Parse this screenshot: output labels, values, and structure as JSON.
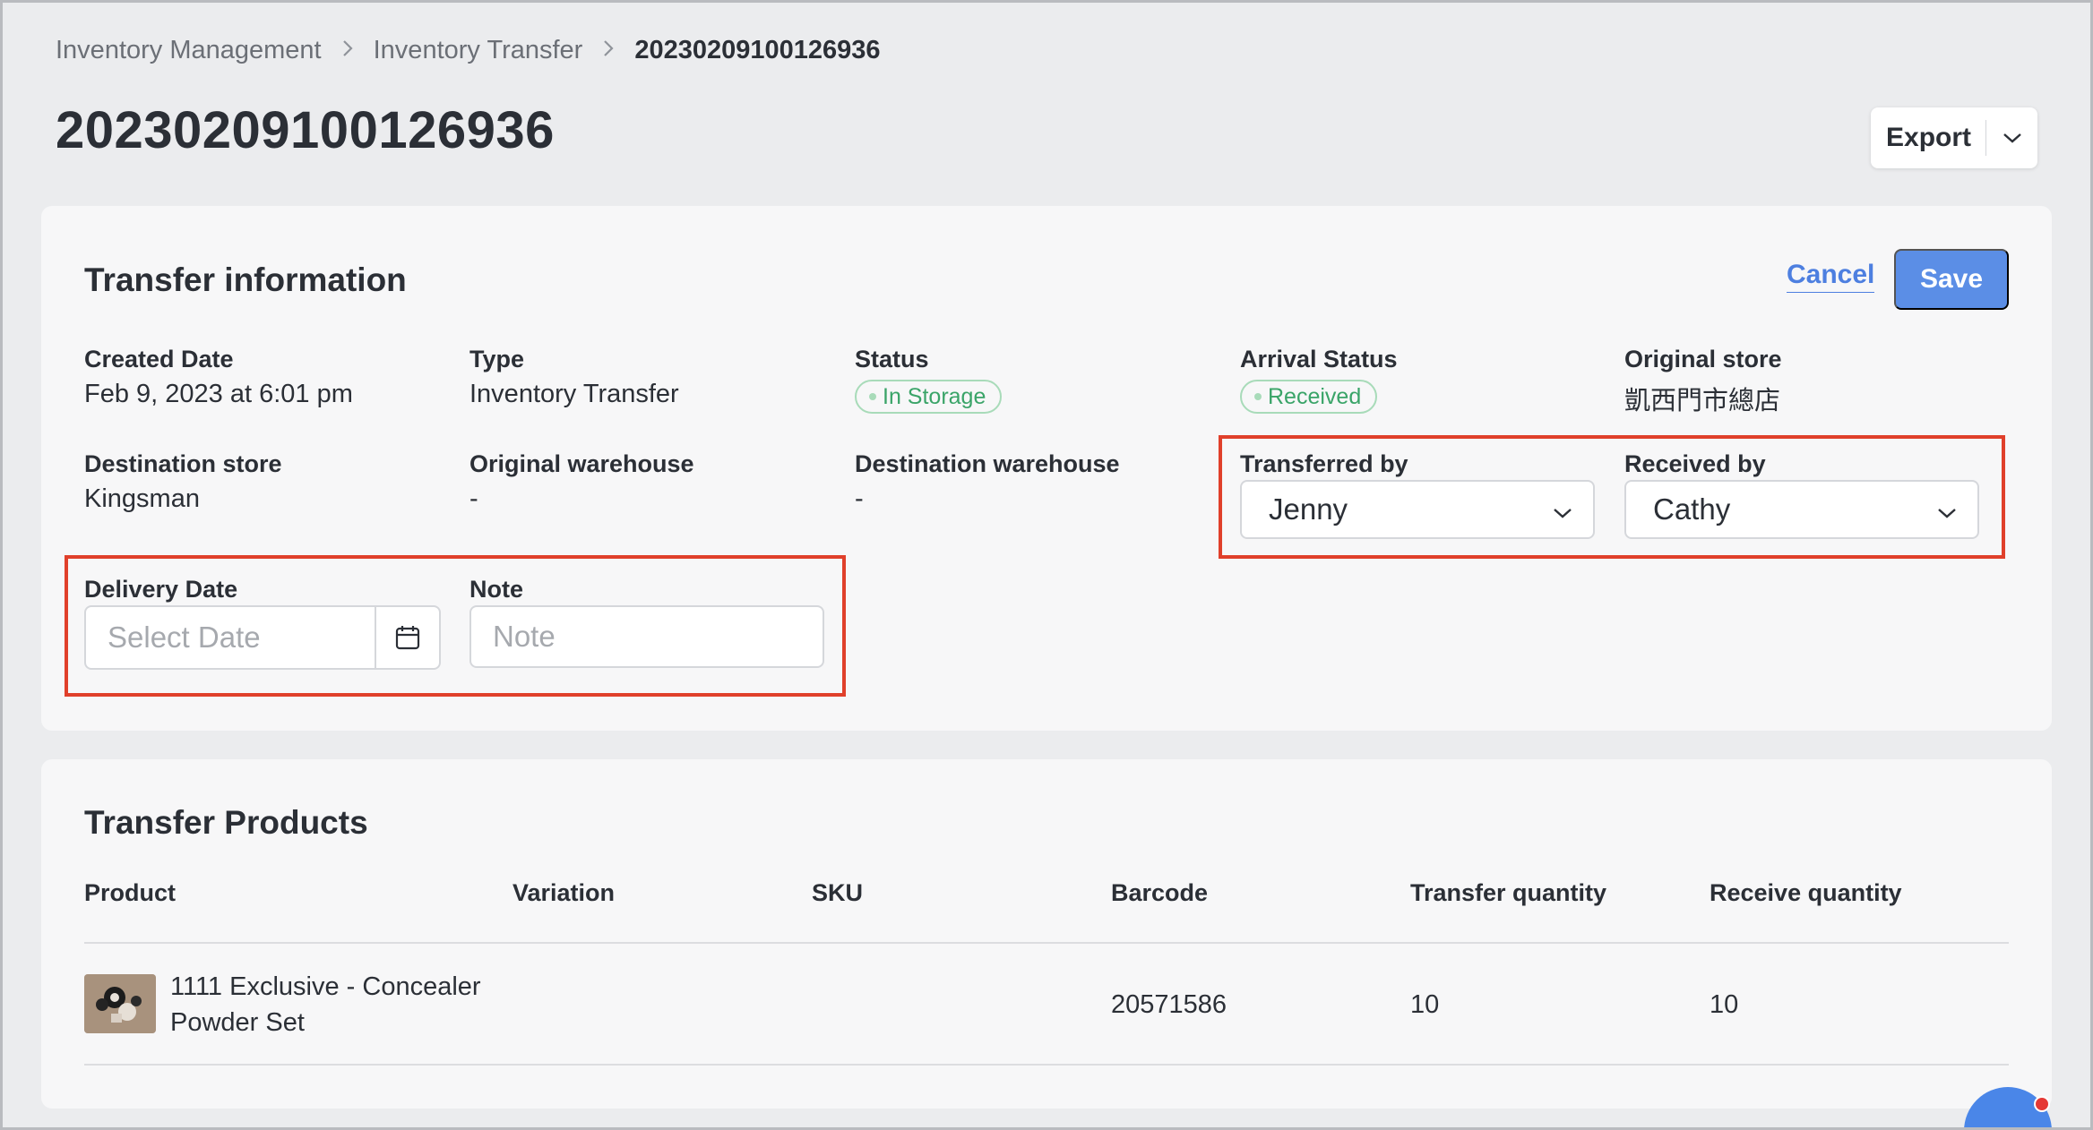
{
  "breadcrumb": {
    "items": [
      "Inventory Management",
      "Inventory Transfer"
    ],
    "current": "20230209100126936",
    "separator": ">"
  },
  "page": {
    "title": "20230209100126936",
    "export_label": "Export"
  },
  "transfer_info": {
    "title": "Transfer information",
    "cancel_label": "Cancel",
    "save_label": "Save",
    "created_date": {
      "label": "Created Date",
      "value": "Feb 9, 2023 at 6:01 pm"
    },
    "type": {
      "label": "Type",
      "value": "Inventory Transfer"
    },
    "status": {
      "label": "Status",
      "value": "In Storage"
    },
    "arrival_status": {
      "label": "Arrival Status",
      "value": "Received"
    },
    "original_store": {
      "label": "Original store",
      "value": "凱西門市總店"
    },
    "destination_store": {
      "label": "Destination store",
      "value": "Kingsman"
    },
    "original_warehouse": {
      "label": "Original warehouse",
      "value": "-"
    },
    "destination_warehouse": {
      "label": "Destination warehouse",
      "value": "-"
    },
    "transferred_by": {
      "label": "Transferred by",
      "value": "Jenny"
    },
    "received_by": {
      "label": "Received by",
      "value": "Cathy"
    },
    "delivery_date": {
      "label": "Delivery Date",
      "placeholder": "Select Date"
    },
    "note": {
      "label": "Note",
      "placeholder": "Note"
    }
  },
  "transfer_products": {
    "title": "Transfer Products",
    "columns": [
      "Product",
      "Variation",
      "SKU",
      "Barcode",
      "Transfer quantity",
      "Receive quantity"
    ],
    "rows": [
      {
        "product_line1": "1111 Exclusive - Concealer",
        "product_line2": "Powder Set",
        "variation": "",
        "sku": "",
        "barcode": "20571586",
        "transfer_quantity": "10",
        "receive_quantity": "10"
      }
    ]
  },
  "colors": {
    "accent": "#5b8ee6",
    "link": "#4d7fe0",
    "status_green": "#3aa468",
    "highlight_red": "#e0402b",
    "background": "#ebecee",
    "card": "#f7f7f8"
  },
  "icons": {
    "breadcrumb_separator": "chevron-right-icon",
    "export_menu": "chevron-down-icon",
    "select_arrow": "chevron-down-icon",
    "date_picker": "calendar-icon",
    "chat": "chat-icon"
  }
}
